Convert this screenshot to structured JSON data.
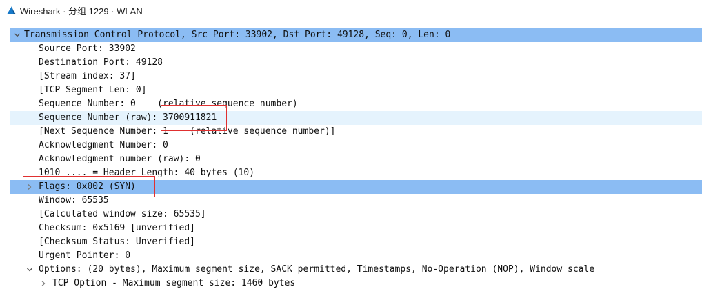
{
  "window": {
    "title": "Wireshark · 分组 1229 · WLAN",
    "app_icon": "wireshark-fin-icon"
  },
  "tree": {
    "rows": [
      {
        "label": "Transmission Control Protocol, Src Port: 33902, Dst Port: 49128, Seq: 0, Len: 0",
        "level": 0,
        "toggle": "expanded",
        "state": "selected"
      },
      {
        "label": "Source Port: 33902",
        "level": 1
      },
      {
        "label": "Destination Port: 49128",
        "level": 1
      },
      {
        "label": "[Stream index: 37]",
        "level": 1
      },
      {
        "label": "[TCP Segment Len: 0]",
        "level": 1
      },
      {
        "label": "Sequence Number: 0    (relative sequence number)",
        "level": 1
      },
      {
        "label": "Sequence Number (raw): 3700911821",
        "level": 1,
        "state": "hover"
      },
      {
        "label": "[Next Sequence Number: 1    (relative sequence number)]",
        "level": 1
      },
      {
        "label": "Acknowledgment Number: 0",
        "level": 1
      },
      {
        "label": "Acknowledgment number (raw): 0",
        "level": 1
      },
      {
        "label": "1010 .... = Header Length: 40 bytes (10)",
        "level": 1
      },
      {
        "label": "Flags: 0x002 (SYN)",
        "level": 1,
        "toggle": "collapsed",
        "state": "selected"
      },
      {
        "label": "Window: 65535",
        "level": 1
      },
      {
        "label": "[Calculated window size: 65535]",
        "level": 1
      },
      {
        "label": "Checksum: 0x5169 [unverified]",
        "level": 1
      },
      {
        "label": "[Checksum Status: Unverified]",
        "level": 1
      },
      {
        "label": "Urgent Pointer: 0",
        "level": 1
      },
      {
        "label": "Options: (20 bytes), Maximum segment size, SACK permitted, Timestamps, No-Operation (NOP), Window scale",
        "level": 1,
        "toggle": "expanded"
      },
      {
        "label": "TCP Option - Maximum segment size: 1460 bytes",
        "level": 2,
        "toggle": "collapsed"
      }
    ]
  },
  "annotations": {
    "color": "#e03030",
    "highlight_seq_raw": "annotation-box-sequence-raw",
    "highlight_flags": "annotation-box-flags"
  },
  "colors": {
    "selected_row": "#8bbcf3",
    "hover_row": "#e5f3fd"
  }
}
